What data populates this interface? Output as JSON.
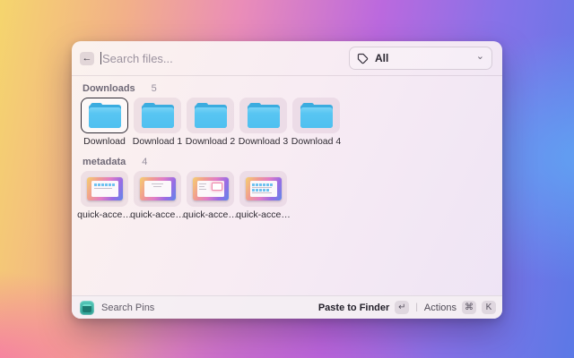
{
  "header": {
    "search_placeholder": "Search files...",
    "filter": {
      "label": "All"
    }
  },
  "icons": {
    "back_arrow": "←",
    "chevron_down": "⌄",
    "tag": "tag-outline-icon",
    "app_icon": "search-pins-app-icon"
  },
  "sections": {
    "downloads": {
      "title": "Downloads",
      "count": "5",
      "items": [
        {
          "label": "Download",
          "selected": true,
          "kind": "folder"
        },
        {
          "label": "Download 1",
          "kind": "folder"
        },
        {
          "label": "Download 2",
          "kind": "folder"
        },
        {
          "label": "Download 3",
          "kind": "folder"
        },
        {
          "label": "Download 4",
          "kind": "folder"
        }
      ]
    },
    "metadata": {
      "title": "metadata",
      "count": "4",
      "items": [
        {
          "label": "quick-acce…",
          "kind": "screenshot"
        },
        {
          "label": "quick-acce…",
          "kind": "screenshot"
        },
        {
          "label": "quick-acce…",
          "kind": "screenshot"
        },
        {
          "label": "quick-acce…",
          "kind": "screenshot"
        }
      ]
    }
  },
  "statusbar": {
    "app_label": "Search Pins",
    "primary_action": "Paste to Finder",
    "primary_key": "↵",
    "divider": "|",
    "secondary_action": "Actions",
    "keys": [
      "⌘",
      "K"
    ]
  },
  "colors": {
    "folder_blue": "#58c5f2",
    "folder_blue_dark": "#3bacdf",
    "app_icon_teal": "#3fb3a6",
    "selection_border": "#2e2a34",
    "bg_gradient": [
      "#f5d56d",
      "#ea8db8",
      "#bb69de",
      "#5b79e6"
    ]
  }
}
